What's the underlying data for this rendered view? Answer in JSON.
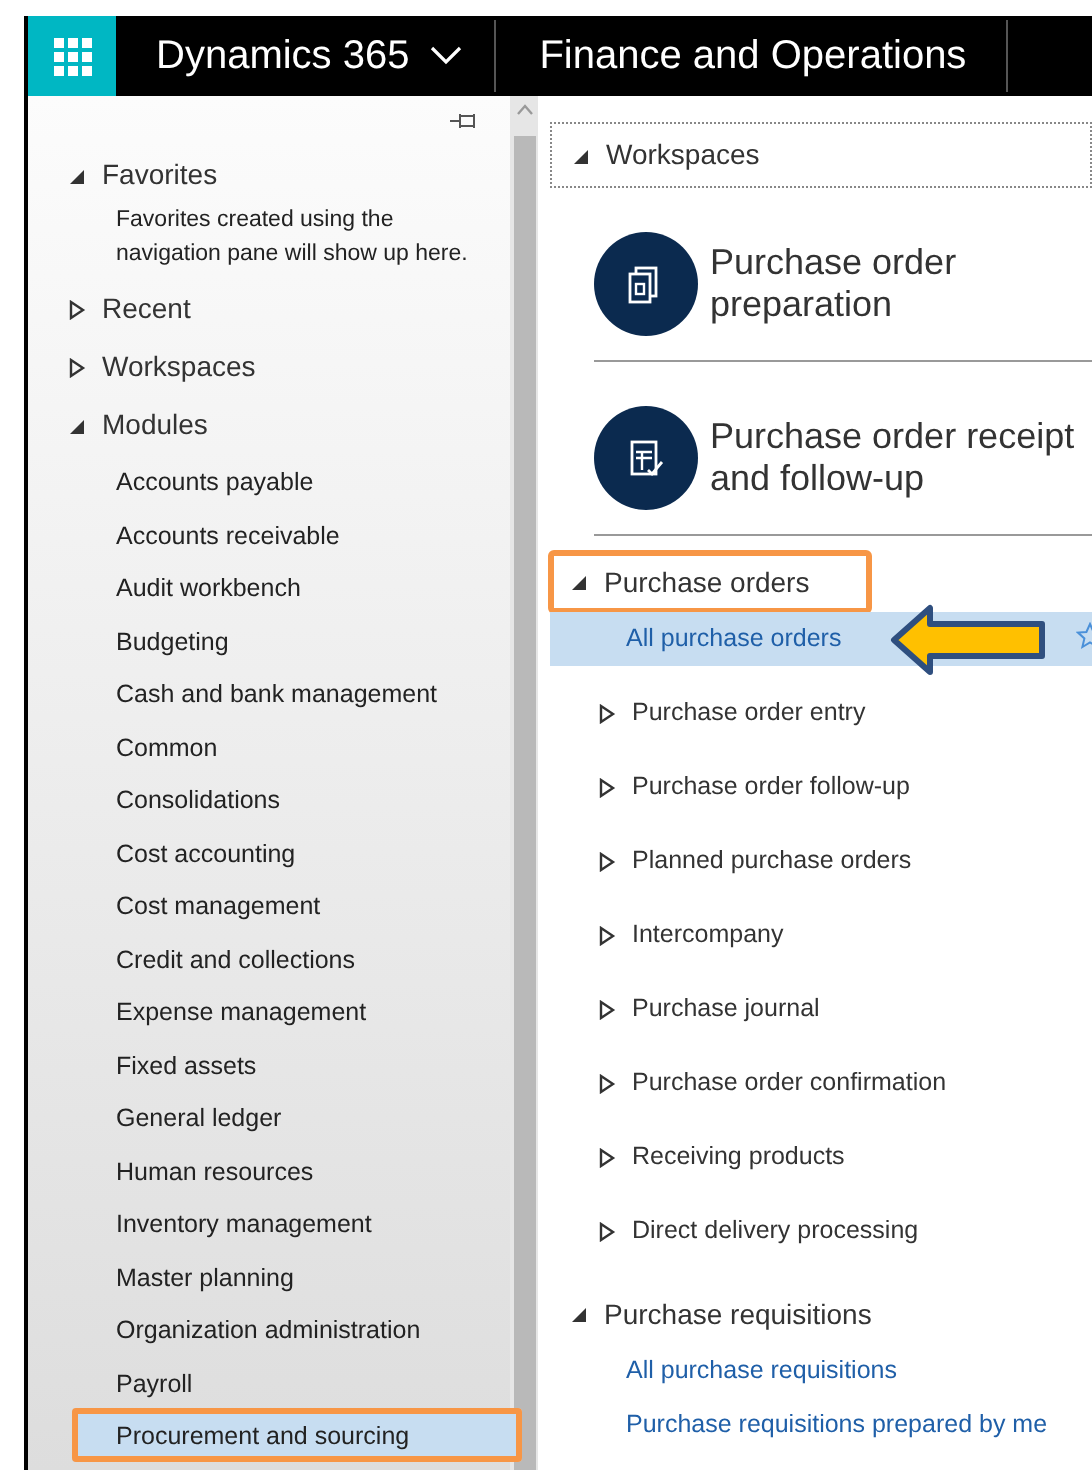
{
  "header": {
    "product": "Dynamics 365",
    "app": "Finance and Operations"
  },
  "nav": {
    "sections": [
      {
        "label": "Favorites",
        "expanded": true,
        "description": "Favorites created using the navigation pane will show up here."
      },
      {
        "label": "Recent",
        "expanded": false
      },
      {
        "label": "Workspaces",
        "expanded": false
      },
      {
        "label": "Modules",
        "expanded": true,
        "items": [
          {
            "label": "Accounts payable",
            "selected": false,
            "highlighted": false
          },
          {
            "label": "Accounts receivable",
            "selected": false,
            "highlighted": false
          },
          {
            "label": "Audit workbench",
            "selected": false,
            "highlighted": false
          },
          {
            "label": "Budgeting",
            "selected": false,
            "highlighted": false
          },
          {
            "label": "Cash and bank management",
            "selected": false,
            "highlighted": false
          },
          {
            "label": "Common",
            "selected": false,
            "highlighted": false
          },
          {
            "label": "Consolidations",
            "selected": false,
            "highlighted": false
          },
          {
            "label": "Cost accounting",
            "selected": false,
            "highlighted": false
          },
          {
            "label": "Cost management",
            "selected": false,
            "highlighted": false
          },
          {
            "label": "Credit and collections",
            "selected": false,
            "highlighted": false
          },
          {
            "label": "Expense management",
            "selected": false,
            "highlighted": false
          },
          {
            "label": "Fixed assets",
            "selected": false,
            "highlighted": false
          },
          {
            "label": "General ledger",
            "selected": false,
            "highlighted": false
          },
          {
            "label": "Human resources",
            "selected": false,
            "highlighted": false
          },
          {
            "label": "Inventory management",
            "selected": false,
            "highlighted": false
          },
          {
            "label": "Master planning",
            "selected": false,
            "highlighted": false
          },
          {
            "label": "Organization administration",
            "selected": false,
            "highlighted": false
          },
          {
            "label": "Payroll",
            "selected": false,
            "highlighted": false
          },
          {
            "label": "Procurement and sourcing",
            "selected": true,
            "highlighted": true
          }
        ]
      }
    ]
  },
  "content": {
    "workspaces": {
      "label": "Workspaces",
      "expanded": true,
      "tiles": [
        {
          "title": "Purchase order preparation",
          "kind": "preparation"
        },
        {
          "title": "Purchase order receipt and follow-up",
          "kind": "receipt"
        }
      ]
    },
    "groups": [
      {
        "label": "Purchase orders",
        "expanded": true,
        "highlighted": true,
        "items": [
          {
            "label": "All purchase orders",
            "kind": "link",
            "selected": true,
            "pointed": true
          },
          {
            "label": "Purchase order entry",
            "kind": "folder",
            "selected": false,
            "pointed": false
          },
          {
            "label": "Purchase order follow-up",
            "kind": "folder",
            "selected": false,
            "pointed": false
          },
          {
            "label": "Planned purchase orders",
            "kind": "folder",
            "selected": false,
            "pointed": false
          },
          {
            "label": "Intercompany",
            "kind": "folder",
            "selected": false,
            "pointed": false
          },
          {
            "label": "Purchase journal",
            "kind": "folder",
            "selected": false,
            "pointed": false
          },
          {
            "label": "Purchase order confirmation",
            "kind": "folder",
            "selected": false,
            "pointed": false
          },
          {
            "label": "Receiving products",
            "kind": "folder",
            "selected": false,
            "pointed": false
          },
          {
            "label": "Direct delivery processing",
            "kind": "folder",
            "selected": false,
            "pointed": false
          }
        ]
      },
      {
        "label": "Purchase requisitions",
        "expanded": true,
        "highlighted": false,
        "items": [
          {
            "label": "All purchase requisitions",
            "kind": "link",
            "selected": false,
            "pointed": false
          },
          {
            "label": "Purchase requisitions prepared by me",
            "kind": "link",
            "selected": false,
            "pointed": false
          }
        ]
      }
    ]
  }
}
